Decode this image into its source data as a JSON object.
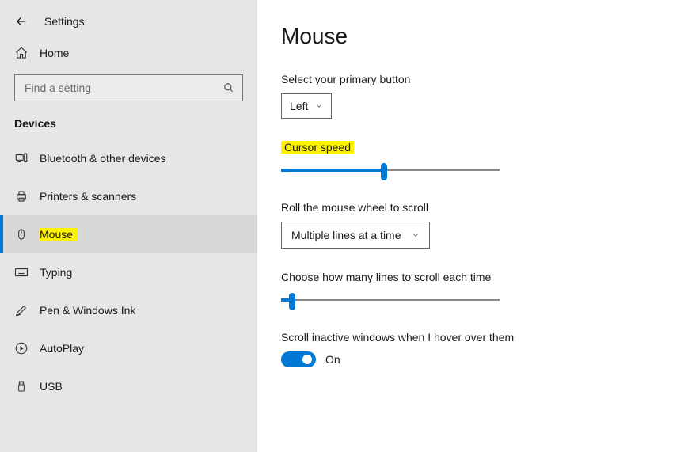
{
  "header": {
    "title": "Settings",
    "home_label": "Home"
  },
  "search": {
    "placeholder": "Find a setting"
  },
  "category": "Devices",
  "sidebar": {
    "items": [
      {
        "label": "Bluetooth & other devices"
      },
      {
        "label": "Printers & scanners"
      },
      {
        "label": "Mouse"
      },
      {
        "label": "Typing"
      },
      {
        "label": "Pen & Windows Ink"
      },
      {
        "label": "AutoPlay"
      },
      {
        "label": "USB"
      }
    ]
  },
  "main": {
    "title": "Mouse",
    "primary_button_label": "Select your primary button",
    "primary_button_value": "Left",
    "cursor_speed_label": "Cursor speed",
    "cursor_speed_percent": 47,
    "scroll_label": "Roll the mouse wheel to scroll",
    "scroll_value": "Multiple lines at a time",
    "lines_label": "Choose how many lines to scroll each time",
    "lines_percent": 5,
    "inactive_label": "Scroll inactive windows when I hover over them",
    "toggle_state": "On"
  },
  "colors": {
    "accent": "#0078d4",
    "highlight": "#fff200"
  }
}
